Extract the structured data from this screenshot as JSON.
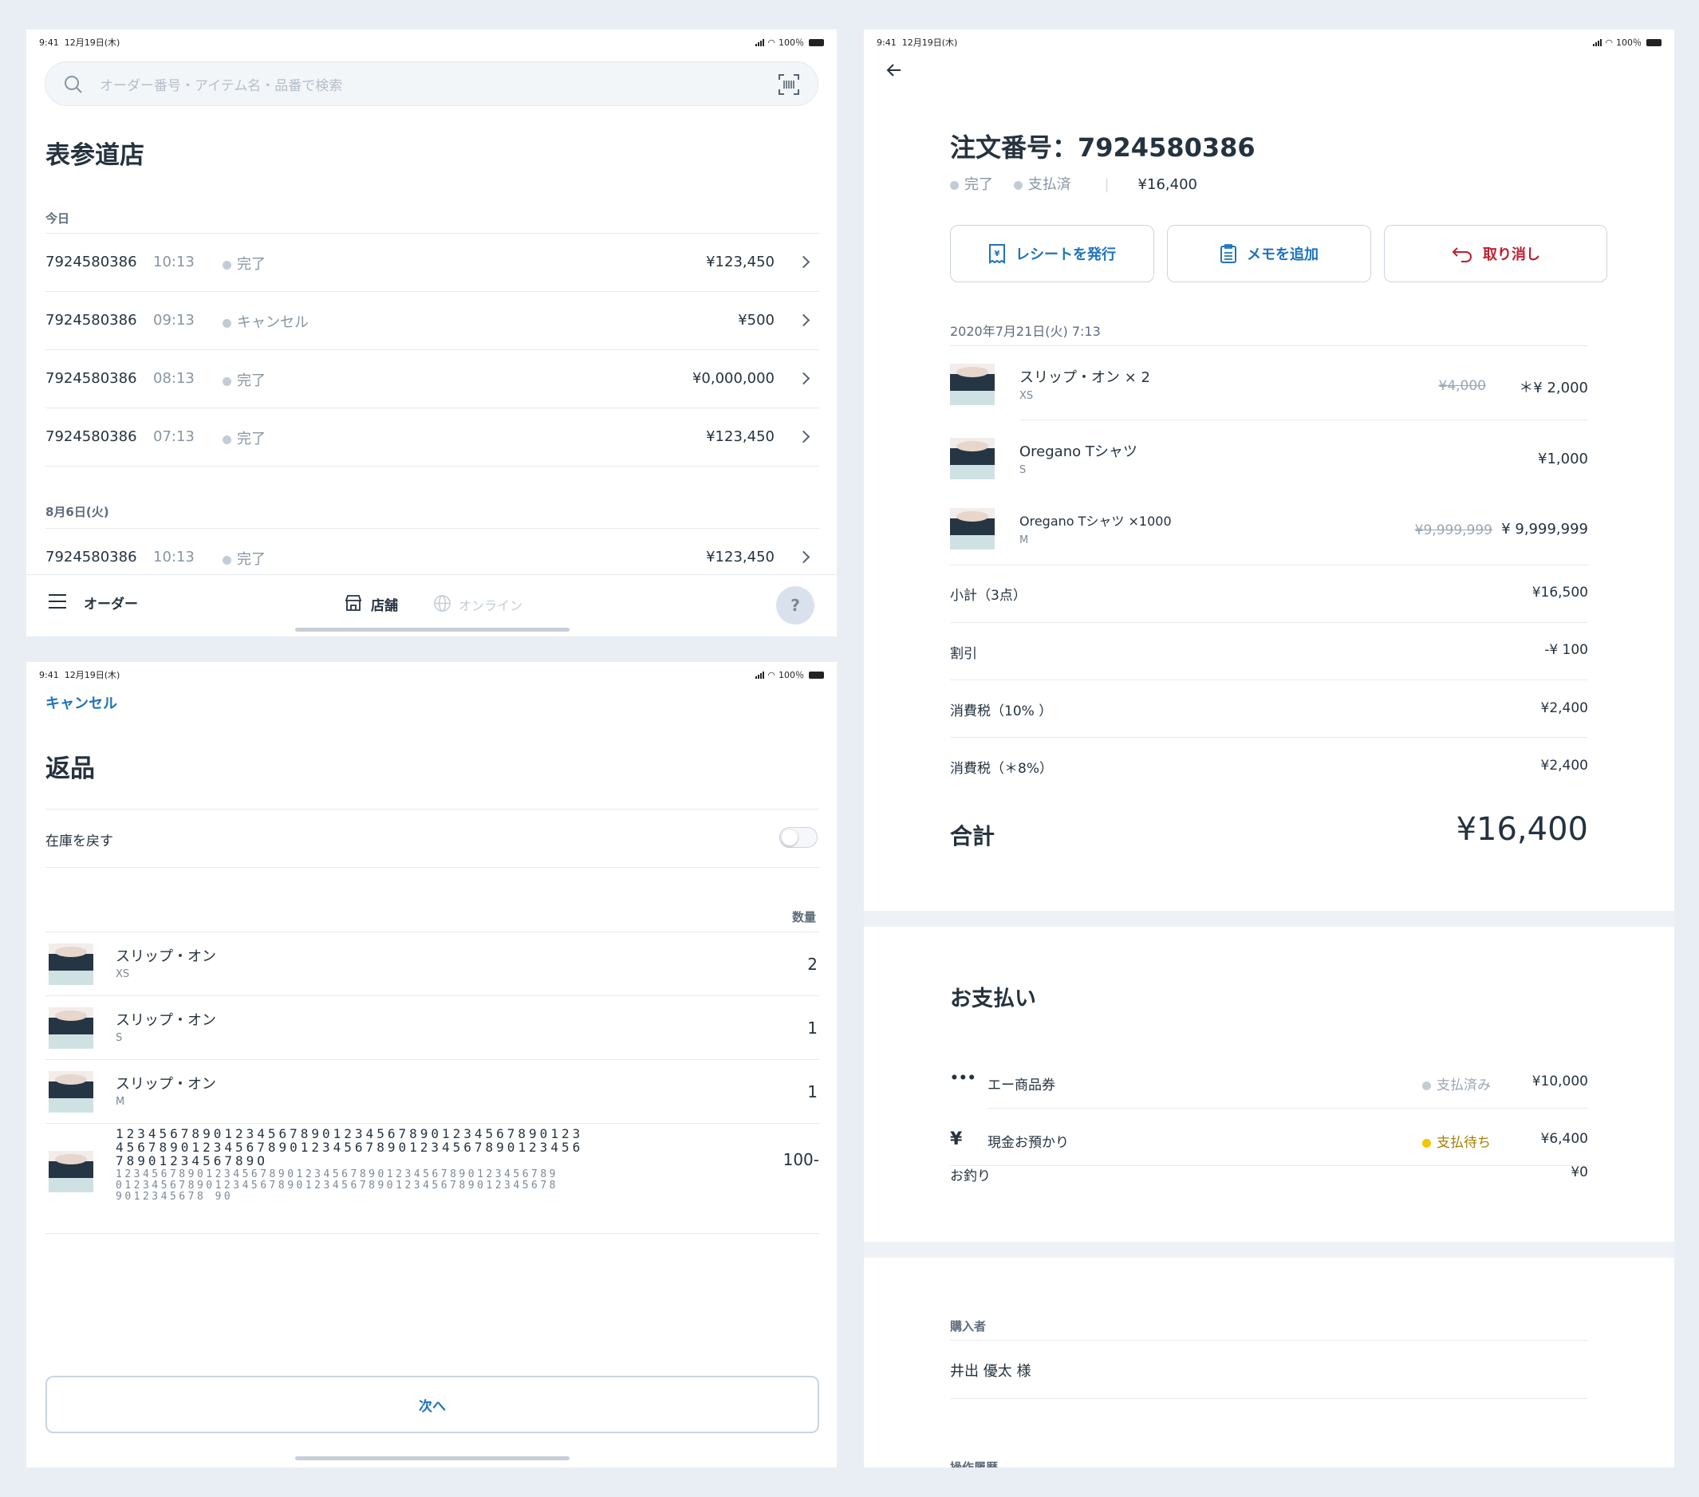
{
  "status": {
    "time": "9:41",
    "date": "12月19日(木)",
    "battery": "100％"
  },
  "orders": {
    "search_placeholder": "オーダー番号・アイテム名・品番で検索",
    "store": "表参道店",
    "today_label": "今日",
    "rows_today": [
      {
        "id": "7924580386",
        "time": "10:13",
        "status": "完了",
        "amount": "¥123,450"
      },
      {
        "id": "7924580386",
        "time": "09:13",
        "status": "キャンセル",
        "amount": "¥500"
      },
      {
        "id": "7924580386",
        "time": "08:13",
        "status": "完了",
        "amount": "¥0,000,000"
      },
      {
        "id": "7924580386",
        "time": "07:13",
        "status": "完了",
        "amount": "¥123,450"
      }
    ],
    "date2_label": "8月6日(火)",
    "rows_aug": [
      {
        "id": "7924580386",
        "time": "10:13",
        "status": "完了",
        "amount": "¥123,450"
      }
    ],
    "tabbar": {
      "orders": "オーダー",
      "store": "店舗",
      "online": "オンライン",
      "help": "?"
    }
  },
  "returns": {
    "cancel": "キャンセル",
    "title": "返品",
    "restock": "在庫を戻す",
    "qty_header": "数量",
    "items": [
      {
        "name": "スリップ・オン",
        "variant": "XS",
        "qty": "2"
      },
      {
        "name": "スリップ・オン",
        "variant": "S",
        "qty": "1"
      },
      {
        "name": "スリップ・オン",
        "variant": "M",
        "qty": "1"
      }
    ],
    "long_item": {
      "name_l1": "1234567890123456789012345678901234567890123",
      "name_l2": "4567890123456789012345678901234567890123456",
      "name_l3": "7890123456789O",
      "var_l1": "1234567890123456789012345678901234567890123456789",
      "var_l2": "0123456789012345678901234567890123456789012345678",
      "var_l3": "9012345678 90",
      "qty": "100-"
    },
    "next": "次へ"
  },
  "detail": {
    "title": "注文番号：7924580386",
    "status_done": "完了",
    "status_paid": "支払済",
    "sep": "|",
    "total_small": "¥16,400",
    "btn_receipt": "レシートを発行",
    "btn_memo": "メモを追加",
    "btn_cancel": "取り消し",
    "datetime": "2020年7月21日(火) 7:13",
    "items": [
      {
        "name": "スリップ・オン × 2",
        "variant": "XS",
        "old": "¥4,000",
        "price": "＊¥ 2,000"
      },
      {
        "name": "Oregano Tシャツ",
        "variant": "S",
        "old": "",
        "price": "¥1,000"
      },
      {
        "name": "Oregano Tシャツ ×1000",
        "variant": "M",
        "old": "¥9,999,999",
        "price": "¥ 9,999,999"
      }
    ],
    "subtotal_label": "小計（3点）",
    "subtotal": "¥16,500",
    "discount_label": "割引",
    "discount": "-¥ 100",
    "tax10_label": "消費税（10% ）",
    "tax10": "¥2,400",
    "tax8_label": "消費税（＊8%）",
    "tax8": "¥2,400",
    "total_label": "合計",
    "total": "¥16,400",
    "payment_title": "お支払い",
    "payments": [
      {
        "icon": "•••",
        "method": "エー商品券",
        "status": "支払済み",
        "amount": "¥10,000"
      },
      {
        "icon": "¥",
        "method": "現金お預かり",
        "status": "支払待ち",
        "amount": "¥6,400"
      }
    ],
    "change_label": "お釣り",
    "change": "¥0",
    "buyer_label": "購入者",
    "buyer": "井出 優太 様",
    "history_label": "操作履歴"
  },
  "colors": {
    "accent": "#1e73be",
    "danger": "#c01e2e",
    "pending": "#f2c600",
    "muted": "#c3ccd6"
  }
}
